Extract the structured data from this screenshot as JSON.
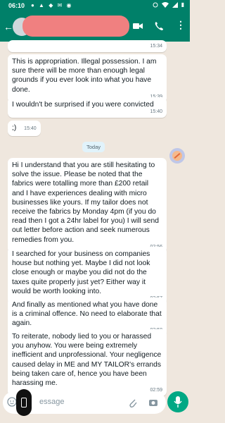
{
  "status_bar": {
    "time": "06:10"
  },
  "header": {
    "contact_name": ""
  },
  "messages": [
    {
      "text": "",
      "time": "15:34"
    },
    {
      "text": "This is appropriation. Illegal possession. I am sure there will be more than enough legal grounds if you ever look into what you have done.",
      "time": "15:39"
    },
    {
      "text": "I wouldn't be surprised if you were convicted",
      "time": "15:40"
    },
    {
      "text": ";)",
      "time": "15:40"
    }
  ],
  "date_separator": "Today",
  "messages_today": [
    {
      "text": "Hi I understand that you are still hesitating to solve the issue. Please be noted that the fabrics were totalling more than £200 retail and I have experiences dealing with micro businesses like yours. If my tailor does not receive the fabrics by Monday 4pm (if you do read then I got a 24hr label for you) I will send out letter before action and seek numerous remedies from you.",
      "time": "02:56"
    },
    {
      "text": "I searched for your business on companies house but nothing yet. Maybe I did not look close enough or maybe you did not do the taxes quite properly just yet? Either way it would be worth looking into.",
      "time": "02:57"
    },
    {
      "text": "And finally as mentioned what you have done is a criminal offence. No need to elaborate that again.",
      "time": "02:58"
    },
    {
      "text": "To reiterate, nobody lied to you or harassed you anyhow. You were being extremely inefficient and unprofessional. Your negligence caused delay in ME and MY TAILOR's errands being taken care of, hence you have been harassing me.",
      "time": "02:59"
    }
  ],
  "composer": {
    "placeholder": "essage"
  },
  "colors": {
    "header": "#008069",
    "chat_bg": "#efe7de",
    "bubble": "#ffffff",
    "accent": "#00a884"
  },
  "icons": [
    "back-arrow-icon",
    "video-call-icon",
    "phone-call-icon",
    "more-menu-icon",
    "emoji-icon",
    "attach-icon",
    "camera-icon",
    "mic-icon"
  ]
}
